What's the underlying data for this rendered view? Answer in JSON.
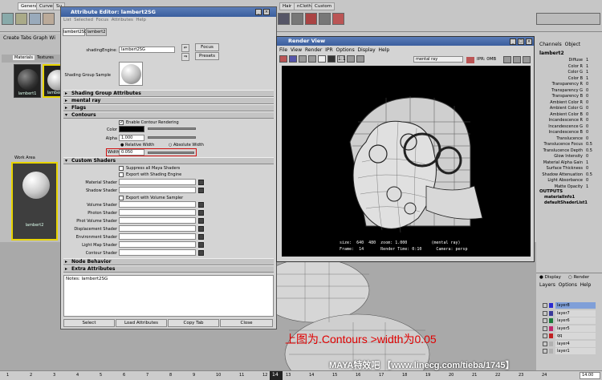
{
  "shelf": {
    "tabs": [
      "General",
      "Curves",
      "Su",
      "Hair",
      "nCloth",
      "Custom"
    ],
    "active_tab": "General"
  },
  "left_panel": {
    "menu": [
      "Create",
      "Tabs",
      "Graph",
      "Wi"
    ],
    "tabs": [
      "Materials",
      "Textures"
    ],
    "swatches": [
      "lambert1",
      "lambert2"
    ],
    "work_area_label": "Work Area",
    "work_swatch": "lambert2"
  },
  "attr_editor": {
    "title": "Attribute Editor: lambert2SG",
    "menu": [
      "List",
      "Selected",
      "Focus",
      "Attributes",
      "Help"
    ],
    "tabs": [
      "lambert2SG",
      "lambert2"
    ],
    "shading_engine_label": "shadingEngine:",
    "shading_engine_value": "lambert2SG",
    "focus_btn": "Focus",
    "presets_btn": "Presets",
    "sample_label": "Shading Group Sample",
    "sections": {
      "sga": "Shading Group Attributes",
      "mental_ray": "mental ray",
      "flags": "Flags",
      "contours": "Contours",
      "custom_shaders": "Custom Shaders",
      "node_behavior": "Node Behavior",
      "extra": "Extra Attributes"
    },
    "contours": {
      "enable_label": "Enable Contour Rendering",
      "color_label": "Color",
      "alpha_label": "Alpha",
      "alpha_value": "1.000",
      "relative_label": "Relative Width",
      "absolute_label": "Absolute Width",
      "width_label": "Width",
      "width_value": "0.050"
    },
    "custom": {
      "suppress_label": "Suppress all Maya Shaders",
      "export_engine_label": "Export with Shading Engine",
      "material_shader": "Material Shader",
      "shadow_shader": "Shadow Shader",
      "export_volume_label": "Export with Volume Sampler",
      "volume_shader": "Volume Shader",
      "photon_shader": "Photon Shader",
      "photon_volume_shader": "Phot Volume Shader",
      "displacement_shader": "Displacement Shader",
      "environment_shader": "Environment Shader",
      "light_map_shader": "Light Map Shader",
      "contour_shader": "Contour Shader"
    },
    "notes_label": "Notes: lambert2SG",
    "buttons": [
      "Select",
      "Load Attributes",
      "Copy Tab",
      "Close"
    ]
  },
  "render_view": {
    "title": "Render View",
    "menu": [
      "File",
      "View",
      "Render",
      "IPR",
      "Options",
      "Display",
      "Help"
    ],
    "renderer": "mental ray",
    "ipr_label": "IPR: 0MB",
    "stats_line1": "size:  640  480  zoom: 1.000          (mental ray)",
    "stats_line2": "Frame:  14       Render Time: 0:10      Camera: persp"
  },
  "channel_box": {
    "header": [
      "Channels",
      "Object"
    ],
    "node": "lambert2",
    "rows": [
      {
        "k": "Diffuse",
        "v": "1"
      },
      {
        "k": "Color R",
        "v": "1"
      },
      {
        "k": "Color G",
        "v": "1"
      },
      {
        "k": "Color B",
        "v": "1"
      },
      {
        "k": "Transparency R",
        "v": "0"
      },
      {
        "k": "Transparency G",
        "v": "0"
      },
      {
        "k": "Transparency B",
        "v": "0"
      },
      {
        "k": "Ambient Color R",
        "v": "0"
      },
      {
        "k": "Ambient Color G",
        "v": "0"
      },
      {
        "k": "Ambient Color B",
        "v": "0"
      },
      {
        "k": "Incandescence R",
        "v": "0"
      },
      {
        "k": "Incandescence G",
        "v": "0"
      },
      {
        "k": "Incandescence B",
        "v": "0"
      },
      {
        "k": "Translucence",
        "v": "0"
      },
      {
        "k": "Translucence Focus",
        "v": "0.5"
      },
      {
        "k": "Translucence Depth",
        "v": "0.5"
      },
      {
        "k": "Glow Intensity",
        "v": "0"
      },
      {
        "k": "Material Alpha Gain",
        "v": "1"
      },
      {
        "k": "Surface Thickness",
        "v": "0"
      },
      {
        "k": "Shadow Attenuation",
        "v": "0.5"
      },
      {
        "k": "Light Absorbance",
        "v": "0"
      },
      {
        "k": "Matte Opacity",
        "v": "1"
      }
    ],
    "outputs_label": "OUTPUTS",
    "outputs": [
      "materialInfo1",
      "defaultShaderList1"
    ]
  },
  "layers": {
    "display_label": "Display",
    "render_label": "Render",
    "menu": [
      "Layers",
      "Options",
      "Help"
    ],
    "items": [
      {
        "name": "layer8",
        "color": "#2b2bd0",
        "sel": true
      },
      {
        "name": "layer7",
        "color": "#3a3a9a",
        "sel": false
      },
      {
        "name": "layer6",
        "color": "#1a7a3a",
        "sel": false
      },
      {
        "name": "layer5",
        "color": "#c0286e",
        "sel": false
      },
      {
        "name": "qq",
        "color": "#c02020",
        "sel": false
      },
      {
        "name": "layer4",
        "color": "#b0b0b0",
        "sel": false
      },
      {
        "name": "layer1",
        "color": "#b0b0b0",
        "sel": false
      }
    ]
  },
  "timeline": {
    "frame_ticks": [
      "1",
      "2",
      "3",
      "4",
      "5",
      "6",
      "7",
      "8",
      "9",
      "10",
      "11",
      "12",
      "13",
      "14",
      "15",
      "16",
      "17",
      "18",
      "19",
      "20",
      "21",
      "22",
      "23",
      "24"
    ],
    "current": "14",
    "end_value": "14.00"
  },
  "caption": "上图为.Contours >width为0.05",
  "watermark": "MAYA特效吧 【www.linecg.com/tieba/1745】",
  "colors": {
    "accent_red": "#e00000",
    "title_blue": "#3a5e9e"
  }
}
